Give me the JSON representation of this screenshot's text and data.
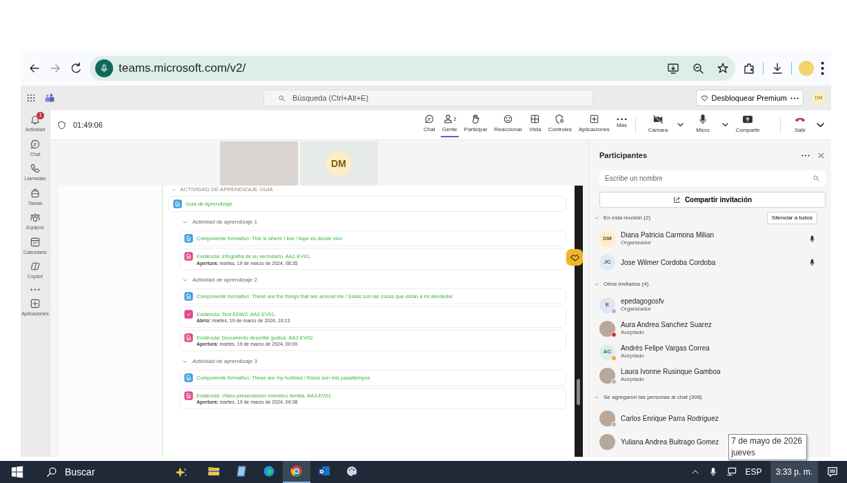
{
  "browser": {
    "url": "teams.microsoft.com/v2/"
  },
  "teams_bar": {
    "search_placeholder": "Búsqueda (Ctrl+Alt+E)",
    "premium_button": "Desbloquear Premium",
    "avatar": "DM"
  },
  "rail": [
    {
      "kind": "app",
      "label": "Actividad",
      "badge": "1"
    },
    {
      "kind": "app",
      "label": "Chat"
    },
    {
      "kind": "app",
      "label": "Llamadas"
    },
    {
      "kind": "app",
      "label": "Tareas"
    },
    {
      "kind": "app",
      "label": "Equipos"
    },
    {
      "kind": "app",
      "label": "Calendario"
    },
    {
      "kind": "app",
      "label": "Copilot"
    },
    {
      "kind": "more"
    },
    {
      "kind": "app",
      "label": "Aplicaciones"
    }
  ],
  "meeting": {
    "timer": "01:49:06",
    "buttons": [
      {
        "label": "Chat",
        "selected": false
      },
      {
        "label": "Gente",
        "count": "2",
        "selected": true
      },
      {
        "label": "Participar",
        "selected": false
      },
      {
        "label": "Reaccionar",
        "selected": false
      },
      {
        "label": "Vista",
        "selected": false
      },
      {
        "label": "Controles",
        "selected": false
      },
      {
        "label": "Aplicaciones",
        "selected": false
      },
      {
        "label": "Más",
        "selected": false
      }
    ],
    "device_buttons": [
      {
        "label": "Cámara",
        "caret": true
      },
      {
        "label": "Micro",
        "caret": true
      },
      {
        "label": "Compartir",
        "caret": false
      }
    ],
    "leave_button": {
      "label": "Salir"
    }
  },
  "video_tiles": [
    {
      "kind": "photo"
    },
    {
      "kind": "initials",
      "initials": "DM",
      "color": "#fcefc4"
    }
  ],
  "shared_screen": {
    "heading": "ACTIVIDAD DE APRENDIZAJE GUIA",
    "guide": {
      "kind": "page",
      "title": "Guia de Aprendizaje"
    },
    "sections": [
      {
        "title": "Actividad de aprendizaje 1",
        "items": [
          {
            "kind": "page",
            "title": "Componente formativo: This is where I live / Aquí es donde vivo"
          },
          {
            "kind": "assign",
            "title": "Evidencia: Infografía de su vecindario. AA1-EV01.",
            "date": "**Apertura:** martes, 19 de marzo de 2024, 08:35"
          }
        ]
      },
      {
        "title": "Actividad de aprendizaje 2",
        "items": [
          {
            "kind": "page",
            "title": "Componente formativo: These are the things that are around me / Estas son las cosas que están a mi alrededor"
          },
          {
            "kind": "quiz",
            "title": "Evidencia: Test EDW2. AA2-EV01.",
            "date": "**Abrió:** martes, 19 de marzo de 2024, 10:13"
          },
          {
            "kind": "assign",
            "title": "Evidencia: Documento describir gustos. AA2-EV02.",
            "date": "**Apertura:** martes, 19 de marzo de 2024, 00:00"
          }
        ]
      },
      {
        "title": "Actividad de aprendizaje 3",
        "items": [
          {
            "kind": "page",
            "title": "Componente formativo: These are my hobbies / Estos son mis pasatiempos"
          },
          {
            "kind": "assign",
            "title": "Evidencia: Video-presentación miembro familia. AA3-EV01.",
            "date": "**Apertura:** martes, 19 de marzo de 2024, 09:38"
          }
        ]
      }
    ]
  },
  "participants": {
    "title": "Participantes",
    "search_placeholder": "Escribe un nombre",
    "invite_button": "Compartir invitación",
    "sections": [
      {
        "title": "En esta reunión (2)",
        "expanded": true,
        "action": "Silenciar a todos",
        "people": [
          {
            "avatar": {
              "initials": "DM",
              "color": "#fcefc4"
            },
            "name": "Diana Patricia Carmona Milian",
            "role": "Organizador",
            "mic": true
          },
          {
            "avatar": {
              "initials": "JC",
              "color": "#dcedf0"
            },
            "name": "Jose Wilmer Cordoba Cordoba",
            "mic": true
          }
        ]
      },
      {
        "title": "Otros invitados (4)",
        "expanded": true,
        "people": [
          {
            "avatar": {
              "initials": "E",
              "color": "#dde6f3"
            },
            "name": "epedagogosfv",
            "role": "Organizador",
            "presence": {
              "color": "#b5b5b5"
            }
          },
          {
            "avatar": {
              "kind": "photo"
            },
            "name": "Aura Andrea Sanchez Suarez",
            "role": "Aceptado",
            "presence": {
              "color": "#d13438"
            }
          },
          {
            "avatar": {
              "initials": "AC",
              "color": "#dcedf0"
            },
            "name": "Andrés Felipe Vargas Correa",
            "role": "Aceptado",
            "presence": {
              "color": "#f8a12b"
            }
          },
          {
            "avatar": {
              "kind": "photo"
            },
            "name": "Laura Ivonne Rusinque Gamboa",
            "role": "Aceptado",
            "presence": {
              "color": "#b5b5b5"
            }
          }
        ]
      },
      {
        "title": "Se agregaron las personas al chat (308)",
        "expanded": true,
        "people": [
          {
            "avatar": {
              "kind": "photo"
            },
            "name": "Carlos Enrique Parra Rodriguez",
            "presence": {
              "color": "#b5b5b5"
            }
          },
          {
            "avatar": {
              "kind": "photo"
            },
            "name": "Yuliana Andrea Buitrago Gomez"
          }
        ]
      }
    ]
  },
  "taskbar": {
    "search": "Buscar",
    "apps": [
      {
        "selected": false
      },
      {
        "selected": false
      },
      {
        "selected": false
      },
      {
        "selected": true
      },
      {
        "selected": false
      },
      {
        "selected": false
      }
    ],
    "language": "ESP",
    "time": "3:33 p. m."
  },
  "date_tooltip": {
    "date": "7 de mayo de 2026",
    "weekday": "jueves"
  }
}
